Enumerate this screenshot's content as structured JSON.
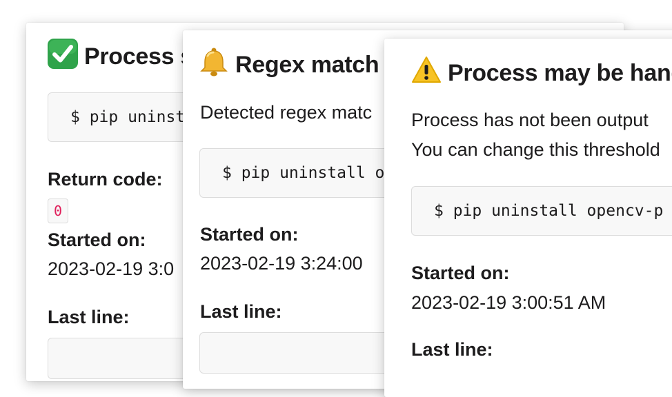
{
  "cards": [
    {
      "title": "Process s",
      "icon": "check-mark-icon",
      "command": "$ pip uninst",
      "return_code_label": "Return code:",
      "return_code": "0",
      "started_label": "Started on:",
      "started_value": "2023-02-19 3:0",
      "last_line_label": "Last line:"
    },
    {
      "title": "Regex match",
      "icon": "bell-icon",
      "description": "Detected regex matc",
      "command": "$ pip uninstall o",
      "started_label": "Started on:",
      "started_value": "2023-02-19 3:24:00",
      "last_line_label": "Last line:"
    },
    {
      "title": "Process may be hang",
      "icon": "warning-icon",
      "description_lines": [
        "Process has not been output",
        "You can change this threshold"
      ],
      "command": "$ pip uninstall opencv-p",
      "started_label": "Started on:",
      "started_value": "2023-02-19 3:00:51 AM",
      "last_line_label": "Last line:"
    }
  ],
  "colors": {
    "return_code": "#e01e5a",
    "check_green": "#2fa34a",
    "bell_gold": "#e9a31c",
    "warning_yellow": "#f7c325"
  }
}
